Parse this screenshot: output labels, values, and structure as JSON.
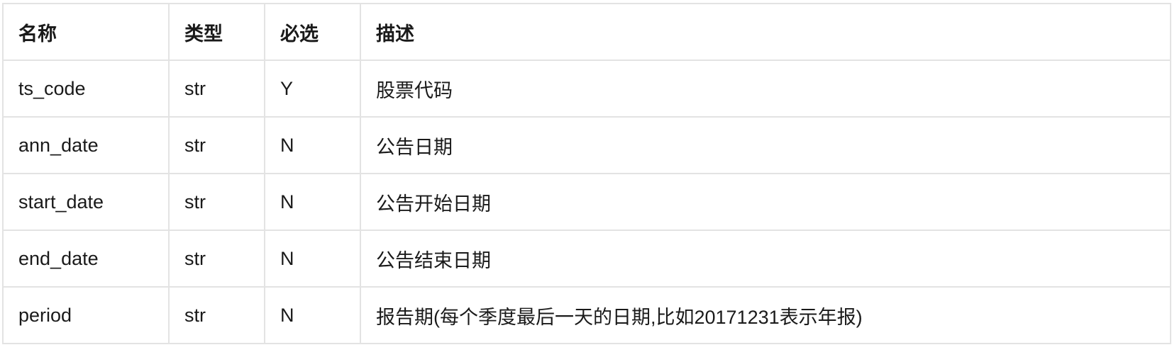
{
  "table": {
    "headers": [
      "名称",
      "类型",
      "必选",
      "描述"
    ],
    "rows": [
      {
        "name": "ts_code",
        "type": "str",
        "required": "Y",
        "description": "股票代码"
      },
      {
        "name": "ann_date",
        "type": "str",
        "required": "N",
        "description": "公告日期"
      },
      {
        "name": "start_date",
        "type": "str",
        "required": "N",
        "description": "公告开始日期"
      },
      {
        "name": "end_date",
        "type": "str",
        "required": "N",
        "description": "公告结束日期"
      },
      {
        "name": "period",
        "type": "str",
        "required": "N",
        "description": "报告期(每个季度最后一天的日期,比如20171231表示年报)"
      }
    ]
  },
  "colors": {
    "border": "#e3e3e3",
    "text": "#1a1a1a",
    "background": "#ffffff"
  }
}
